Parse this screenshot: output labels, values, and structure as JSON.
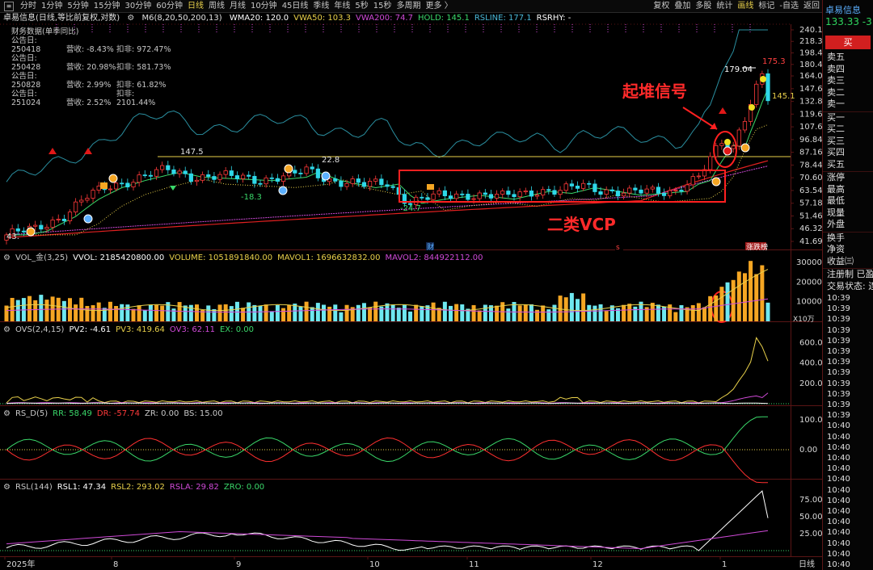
{
  "toolbar": {
    "periods": [
      {
        "label": "分时",
        "active": false
      },
      {
        "label": "1分钟",
        "active": false
      },
      {
        "label": "5分钟",
        "active": false
      },
      {
        "label": "15分钟",
        "active": false
      },
      {
        "label": "30分钟",
        "active": false
      },
      {
        "label": "60分钟",
        "active": false
      },
      {
        "label": "日线",
        "active": true
      },
      {
        "label": "周线",
        "active": false
      },
      {
        "label": "月线",
        "active": false
      },
      {
        "label": "10分钟",
        "active": false
      },
      {
        "label": "45日线",
        "active": false
      },
      {
        "label": "季线",
        "active": false
      },
      {
        "label": "年线",
        "active": false
      },
      {
        "label": "5秒",
        "active": false
      },
      {
        "label": "15秒",
        "active": false
      },
      {
        "label": "多周期",
        "active": false
      },
      {
        "label": "更多 〉",
        "active": false
      }
    ],
    "tools": [
      {
        "label": "复权",
        "hl": false
      },
      {
        "label": "叠加",
        "hl": false
      },
      {
        "label": "多股",
        "hl": false
      },
      {
        "label": "统计",
        "hl": false
      },
      {
        "label": "画线",
        "hl": true
      },
      {
        "label": "标记",
        "hl": false
      },
      {
        "label": "-自选",
        "hl": false
      },
      {
        "label": "返回",
        "hl": false
      }
    ]
  },
  "header": {
    "title": "卓易信息(日线,等比前复权,对数)",
    "ma": "M6(8,20,50,200,13)",
    "indicators": [
      {
        "label": "WMA20: 120.0",
        "color": "#ffffff"
      },
      {
        "label": "VWA50: 103.3",
        "color": "#e8d04a"
      },
      {
        "label": "VWA200: 74.7",
        "color": "#d04ad8"
      },
      {
        "label": "HOLD: 145.1",
        "color": "#3ad86a"
      },
      {
        "label": "RSLINE: 177.1",
        "color": "#4ab8d8"
      },
      {
        "label": "RSRHY: -",
        "color": "#ffffff"
      }
    ]
  },
  "financials": {
    "title": "财务数据(单季同比)",
    "rows": [
      {
        "date": "公告日: 250418",
        "rev": "营收: -8.43%",
        "np": "扣非: 972.47%"
      },
      {
        "date": "公告日: 250428",
        "rev": "营收: 20.98%",
        "np": "扣非: 581.73%"
      },
      {
        "date": "公告日: 250828",
        "rev": "营收: 2.99%",
        "np": "扣非: 61.82%"
      },
      {
        "date": "公告日: 251024",
        "rev": "营收: 2.52%",
        "np": "扣非: 2101.44%"
      }
    ]
  },
  "price_axis": [
    "240.1",
    "218.3",
    "198.4",
    "180.4",
    "164.0",
    "147.6",
    "132.8",
    "119.6",
    "107.6",
    "96.84",
    "87.16",
    "78.44",
    "70.60",
    "63.54",
    "57.18",
    "51.46",
    "46.32",
    "41.69"
  ],
  "chart_labels": {
    "high_147": "147.5",
    "low_183": "-18.3",
    "low_247": "-24.7",
    "peak_1790": "179.04",
    "peak_1753": "175.3",
    "last_1451": "145.1",
    "left_43": "43.",
    "mark_22": "22.8",
    "badge_cai": "财",
    "badge_s": "s",
    "badge_zt": "涨跌榜"
  },
  "annotations": {
    "signal": "起堆信号",
    "vcp": "二类VCP"
  },
  "volume": {
    "header": [
      {
        "label": "VOL_金(3,25)",
        "color": "#c8c8c8"
      },
      {
        "label": "VVOL: 2185420800.00",
        "color": "#ffffff"
      },
      {
        "label": "VOLUME: 1051891840.00",
        "color": "#e8d04a"
      },
      {
        "label": "MAVOL1: 1696632832.00",
        "color": "#e8d04a"
      },
      {
        "label": "MAVOL2: 844922112.00",
        "color": "#d04ad8"
      }
    ],
    "axis": [
      "30000",
      "20000",
      "10000"
    ],
    "unit": "X10万"
  },
  "ovs": {
    "header": [
      {
        "label": "OVS(2,4,15)",
        "color": "#c8c8c8"
      },
      {
        "label": "PV2: -4.61",
        "color": "#ffffff"
      },
      {
        "label": "PV3: 419.64",
        "color": "#e8d04a"
      },
      {
        "label": "OV3: 62.11",
        "color": "#d04ad8"
      },
      {
        "label": "EX: 0.00",
        "color": "#3ad86a"
      }
    ],
    "axis": [
      "600.0",
      "400.0",
      "200.0"
    ]
  },
  "rsd": {
    "header": [
      {
        "label": "RS_D(5)",
        "color": "#c8c8c8"
      },
      {
        "label": "RR: 58.49",
        "color": "#3ad86a"
      },
      {
        "label": "DR: -57.74",
        "color": "#ff3a3a"
      },
      {
        "label": "ZR: 0.00",
        "color": "#c8c8c8"
      },
      {
        "label": "BS: 15.00",
        "color": "#c8c8c8"
      }
    ],
    "axis": [
      "100.0",
      "0.00"
    ]
  },
  "rsl": {
    "header": [
      {
        "label": "RSL(144)",
        "color": "#c8c8c8"
      },
      {
        "label": "RSL1: 47.34",
        "color": "#ffffff"
      },
      {
        "label": "RSL2: 293.02",
        "color": "#e8d04a"
      },
      {
        "label": "RSLA: 29.82",
        "color": "#d04ad8"
      },
      {
        "label": "ZRO: 0.00",
        "color": "#3ad86a"
      }
    ],
    "axis": [
      "75.00",
      "50.00",
      "25.00"
    ]
  },
  "time_axis": {
    "labels": [
      "2025年",
      "8",
      "9",
      "10",
      "11",
      "12",
      "1"
    ],
    "period": "日线"
  },
  "sidebar": {
    "symbol": "卓易信息",
    "price": "133.33  -3",
    "buy_label": "买",
    "asks": [
      "卖五",
      "卖四",
      "卖三",
      "卖二",
      "卖一"
    ],
    "bids": [
      "买一",
      "买二",
      "买三",
      "买四",
      "买五"
    ],
    "stats": [
      "涨停",
      "最高",
      "最低",
      "现量",
      "外盘"
    ],
    "stats2": [
      "换手",
      "净资",
      "收益㈢"
    ],
    "reg": "注册制 已盈",
    "status": "交易状态: 连",
    "times": [
      "10:39",
      "10:39",
      "10:39",
      "10:39",
      "10:39",
      "10:39",
      "10:39",
      "10:39",
      "10:39",
      "10:39",
      "10:39",
      "10:39",
      "10:40",
      "10:40",
      "10:40",
      "10:40",
      "10:40",
      "10:40",
      "10:40",
      "10:40",
      "10:40",
      "10:40",
      "10:40",
      "10:40",
      "10:40",
      "10:40"
    ]
  },
  "colors": {
    "up": "#ff3a3a",
    "down": "#2ed8e8",
    "vol_up": "#f5a623",
    "ma_yellow": "#e8d04a",
    "ma_green": "#3ad86a",
    "ma_purple": "#d04ad8",
    "ma_red": "#e02020",
    "rsline": "#2a8fa0"
  },
  "chart_data": {
    "type": "line",
    "title": "卓易信息(日线,等比前复权,对数)",
    "x": [
      "2025年",
      "8",
      "9",
      "10",
      "11",
      "12",
      "1"
    ],
    "ylim": [
      41.69,
      240.1
    ],
    "series": [
      {
        "name": "WMA20",
        "values": [
          45,
          60,
          80,
          75,
          66,
          64,
          70,
          110,
          145
        ]
      },
      {
        "name": "VWA50",
        "values": [
          44,
          50,
          60,
          66,
          68,
          68,
          70,
          88,
          103.3
        ]
      },
      {
        "name": "VWA200",
        "values": [
          42,
          44,
          48,
          52,
          58,
          61,
          64,
          70,
          74.7
        ]
      },
      {
        "name": "RSLINE",
        "values": [
          90,
          100,
          120,
          130,
          110,
          112,
          116,
          150,
          177.1
        ]
      }
    ]
  }
}
